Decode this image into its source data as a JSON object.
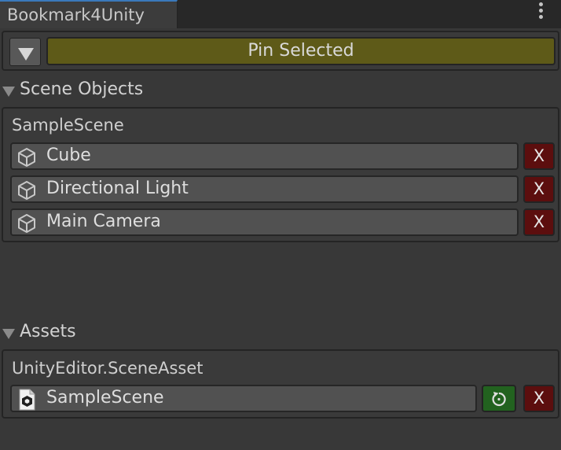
{
  "window": {
    "tab_title": "Bookmark4Unity",
    "menu_icon": "kebab-menu-icon"
  },
  "toolbar": {
    "dropdown_icon": "triangle-down-icon",
    "pin_label": "Pin Selected"
  },
  "scene_objects": {
    "header": "Scene Objects",
    "group_title": "SampleScene",
    "items": [
      {
        "label": "Cube",
        "icon": "cube-icon",
        "remove_label": "X"
      },
      {
        "label": "Directional Light",
        "icon": "cube-icon",
        "remove_label": "X"
      },
      {
        "label": "Main Camera",
        "icon": "cube-icon",
        "remove_label": "X"
      }
    ]
  },
  "assets": {
    "header": "Assets",
    "group_title": "UnityEditor.SceneAsset",
    "items": [
      {
        "label": "SampleScene",
        "icon": "unity-scene-icon",
        "reload_icon": "refresh-icon",
        "remove_label": "X"
      }
    ]
  },
  "colors": {
    "pin_button": "#5e5a18",
    "remove_button": "#5c0e0e",
    "reload_button": "#22621f",
    "tab_accent": "#3a79bb"
  }
}
